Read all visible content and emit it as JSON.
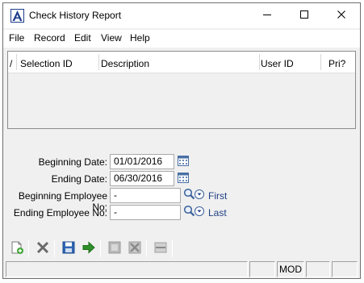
{
  "window": {
    "title": "Check History Report",
    "controls": {
      "minimize_icon": "minimize-icon",
      "maximize_icon": "maximize-icon",
      "close_icon": "close-icon"
    }
  },
  "menu": [
    "File",
    "Record",
    "Edit",
    "View",
    "Help"
  ],
  "grid": {
    "columns": [
      {
        "label": "/"
      },
      {
        "label": "Selection ID"
      },
      {
        "label": "Description"
      },
      {
        "label": "User ID"
      },
      {
        "label": "Pri?"
      }
    ],
    "rows": []
  },
  "form": {
    "beginning_date": {
      "label": "Beginning Date:",
      "value": "01/01/2016",
      "icon": "calendar-icon"
    },
    "ending_date": {
      "label": "Ending Date:",
      "value": "06/30/2016",
      "icon": "calendar-icon"
    },
    "beginning_employee": {
      "label": "Beginning Employee No:",
      "value": "-",
      "icons": [
        "search-icon",
        "dropdown-icon"
      ],
      "link": "First"
    },
    "ending_employee": {
      "label": "Ending Employee No:",
      "value": "-",
      "icons": [
        "search-icon",
        "dropdown-icon"
      ],
      "link": "Last"
    }
  },
  "toolbar": {
    "buttons": [
      "new-record-icon",
      "delete-icon",
      "save-icon",
      "run-icon",
      "print-preview-icon",
      "clear-icon",
      "minimize-panel-icon"
    ]
  },
  "status": {
    "cells": [
      "",
      "",
      "MOD",
      "",
      ""
    ]
  },
  "colors": {
    "accent": "#1f3f86",
    "link": "#1f3f86",
    "window_bg": "#f0f0f0"
  }
}
